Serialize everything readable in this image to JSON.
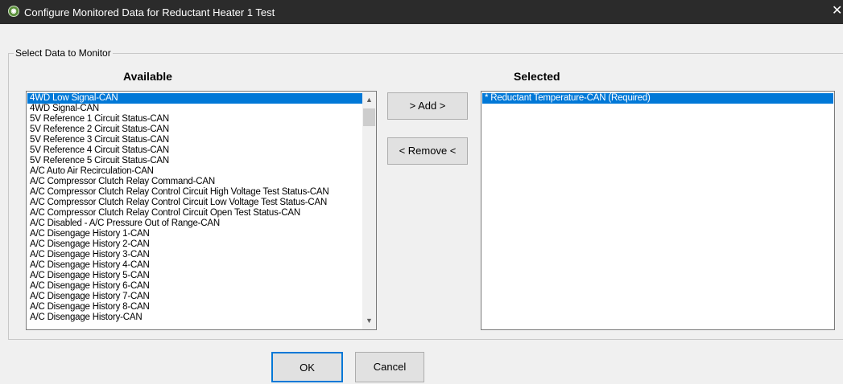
{
  "window": {
    "title": "Configure Monitored Data for Reductant Heater 1 Test",
    "icon": "app-logo-icon",
    "close_glyph": "✕"
  },
  "group": {
    "label": "Select Data to Monitor"
  },
  "available": {
    "header": "Available",
    "selected_index": 0,
    "items": [
      "4WD Low Signal-CAN",
      "4WD Signal-CAN",
      "5V Reference 1 Circuit Status-CAN",
      "5V Reference 2 Circuit Status-CAN",
      "5V Reference 3 Circuit Status-CAN",
      "5V Reference 4 Circuit Status-CAN",
      "5V Reference 5 Circuit Status-CAN",
      "A/C Auto Air Recirculation-CAN",
      "A/C Compressor Clutch Relay Command-CAN",
      "A/C Compressor Clutch Relay Control Circuit High Voltage Test Status-CAN",
      "A/C Compressor Clutch Relay Control Circuit Low Voltage Test Status-CAN",
      "A/C Compressor Clutch Relay Control Circuit Open Test Status-CAN",
      "A/C Disabled - A/C Pressure Out of Range-CAN",
      "A/C Disengage History 1-CAN",
      "A/C Disengage History 2-CAN",
      "A/C Disengage History 3-CAN",
      "A/C Disengage History 4-CAN",
      "A/C Disengage History 5-CAN",
      "A/C Disengage History 6-CAN",
      "A/C Disengage History 7-CAN",
      "A/C Disengage History 8-CAN",
      "A/C Disengage History-CAN"
    ]
  },
  "selected": {
    "header": "Selected",
    "selected_index": 0,
    "items": [
      "* Reductant Temperature-CAN (Required)"
    ]
  },
  "buttons": {
    "add": "> Add >",
    "remove": "< Remove <",
    "ok": "OK",
    "cancel": "Cancel"
  },
  "colors": {
    "selection": "#0078d7",
    "titlebar": "#2b2b2b"
  }
}
